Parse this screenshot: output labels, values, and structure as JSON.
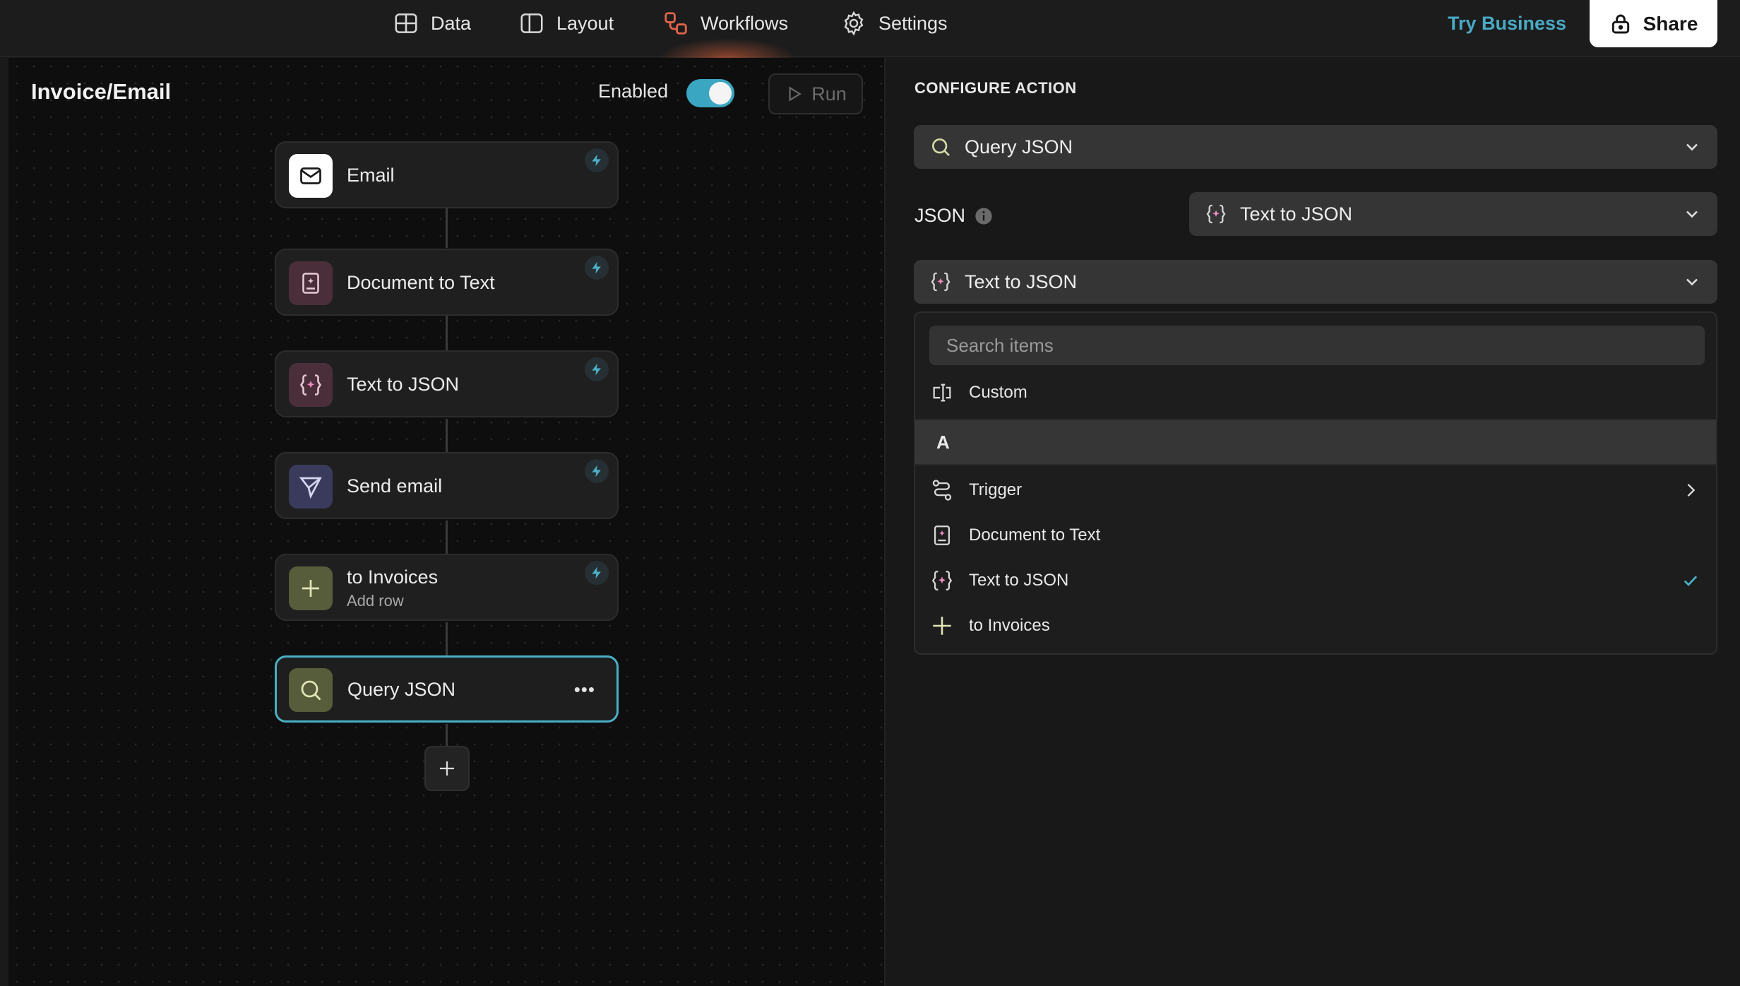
{
  "nav": {
    "data_label": "Data",
    "layout_label": "Layout",
    "workflows_label": "Workflows",
    "settings_label": "Settings",
    "try_business_label": "Try Business",
    "share_label": "Share"
  },
  "workflow": {
    "title": "Invoice/Email",
    "enabled_label": "Enabled",
    "enabled": true,
    "run_label": "Run",
    "nodes": [
      {
        "title": "Email",
        "subtitle": "",
        "icon": "mail-icon",
        "trigger_bolt": true
      },
      {
        "title": "Document to Text",
        "subtitle": "",
        "icon": "document-sparkle-icon",
        "trigger_bolt": true
      },
      {
        "title": "Text to JSON",
        "subtitle": "",
        "icon": "braces-sparkle-icon",
        "trigger_bolt": true
      },
      {
        "title": "Send email",
        "subtitle": "",
        "icon": "send-icon",
        "trigger_bolt": true
      },
      {
        "title": "to Invoices",
        "subtitle": "Add row",
        "icon": "plus-icon",
        "trigger_bolt": true
      },
      {
        "title": "Query JSON",
        "subtitle": "",
        "icon": "search-icon",
        "selected": true,
        "more_label": "•••"
      }
    ]
  },
  "configure": {
    "title": "CONFIGURE ACTION",
    "action_select": "Query JSON",
    "json_label": "JSON",
    "json_select": "Text to JSON",
    "source_select": "Text to JSON",
    "dropdown": {
      "search_placeholder": "Search items",
      "custom_label": "Custom",
      "section_label": "A",
      "items": [
        {
          "label": "Trigger",
          "icon": "route-icon",
          "has_submenu": true
        },
        {
          "label": "Document to Text",
          "icon": "document-sparkle-icon"
        },
        {
          "label": "Text to JSON",
          "icon": "braces-sparkle-icon",
          "selected": true
        },
        {
          "label": "to Invoices",
          "icon": "plus-icon"
        }
      ]
    }
  },
  "colors": {
    "accent": "#49a9c4",
    "toggle_on": "#3aa6c2",
    "workflows_icon": "#e2654a",
    "selected_node_border": "#4aaec4"
  }
}
